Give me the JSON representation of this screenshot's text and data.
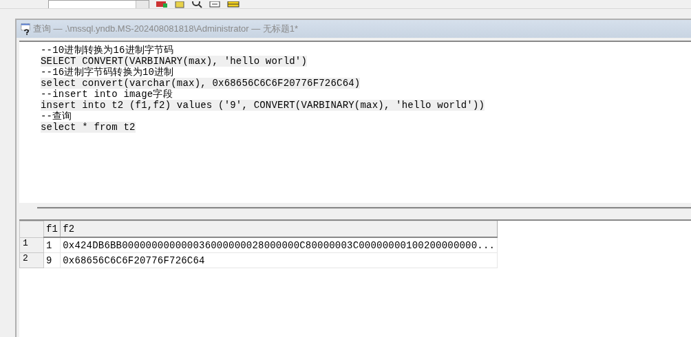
{
  "window": {
    "title": "查询 — .\\mssql.yndb.MS-202408081818\\Administrator — 无标题1*"
  },
  "editor": {
    "lines": [
      {
        "text": "--10进制转换为16进制字节码",
        "kind": "comment"
      },
      {
        "text": "SELECT CONVERT(VARBINARY(max), 'hello world')",
        "kind": "code"
      },
      {
        "text": "--16进制字节码转换为10进制",
        "kind": "comment"
      },
      {
        "text": "select convert(varchar(max), 0x68656C6C6F20776F726C64)",
        "kind": "code"
      },
      {
        "text": "--insert into image字段",
        "kind": "comment"
      },
      {
        "text": "insert into t2 (f1,f2) values ('9', CONVERT(VARBINARY(max), 'hello world'))",
        "kind": "code"
      },
      {
        "text": "--查询",
        "kind": "comment"
      },
      {
        "text": "select * from t2",
        "kind": "code"
      }
    ]
  },
  "results": {
    "columns": [
      "f1",
      "f2"
    ],
    "rows": [
      {
        "number": "1",
        "cells": [
          "1",
          "0x424DB6BB000000000000036000000028000000C80000003C00000000100200000000..."
        ]
      },
      {
        "number": "2",
        "cells": [
          "9",
          "0x68656C6C6F20776F726C64"
        ]
      }
    ]
  }
}
